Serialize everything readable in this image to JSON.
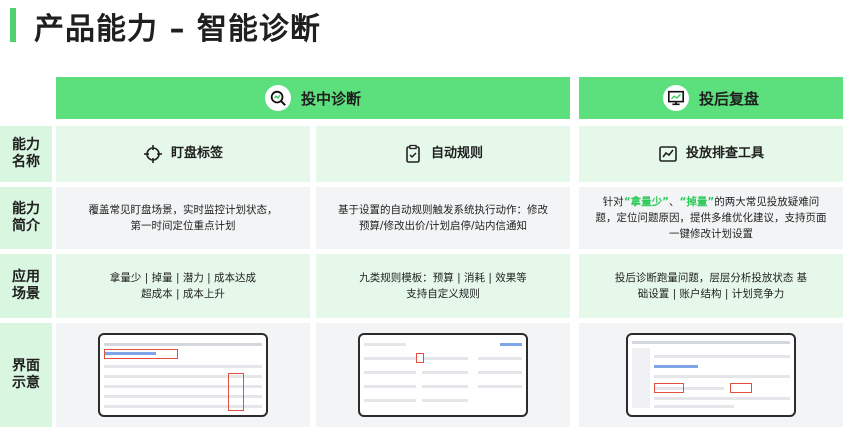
{
  "title": "产品能力 – 智能诊断",
  "sections": [
    {
      "label": "投中诊断",
      "icon": "magnifier-chart-icon"
    },
    {
      "label": "投后复盘",
      "icon": "monitor-chart-icon"
    }
  ],
  "row_labels": {
    "capability_name": "能力名称",
    "capability_intro": "能力简介",
    "scenarios": "应用场景",
    "ui": "界面示意"
  },
  "columns": [
    {
      "name": "盯盘标签",
      "icon": "target-icon",
      "intro": "覆盖常见盯盘场景，实时监控计划状态，第一时间定位重点计划",
      "scenario": "拿量少 | 掉量 | 潜力 | 成本达成 超成本 | 成本上升"
    },
    {
      "name": "自动规则",
      "icon": "clipboard-icon",
      "intro": "基于设置的自动规则触发系统执行动作：修改预算/修改出价/计划启停/站内信通知",
      "scenario": "九类规则模板：预算 | 消耗 | 效果等 支持自定义规则"
    },
    {
      "name": "投放排查工具",
      "icon": "chart-line-icon",
      "intro_prefix": "针对",
      "intro_hl1": "“拿量少”",
      "intro_sep": "、",
      "intro_hl2": "“掉量”",
      "intro_rest": "的两大常见投放疑难问题，定位问题原因，提供多维优化建议，支持页面一键修改计划设置",
      "scenario": "投后诊断跑量问题，层层分析投放状态 基础设置 | 账户结构 | 计划竞争力"
    }
  ],
  "colors": {
    "accent": "#5ce07e",
    "accent_light": "#e5f8ea",
    "label_bg": "#d9f6e1",
    "highlight": "#2ecb5b"
  }
}
